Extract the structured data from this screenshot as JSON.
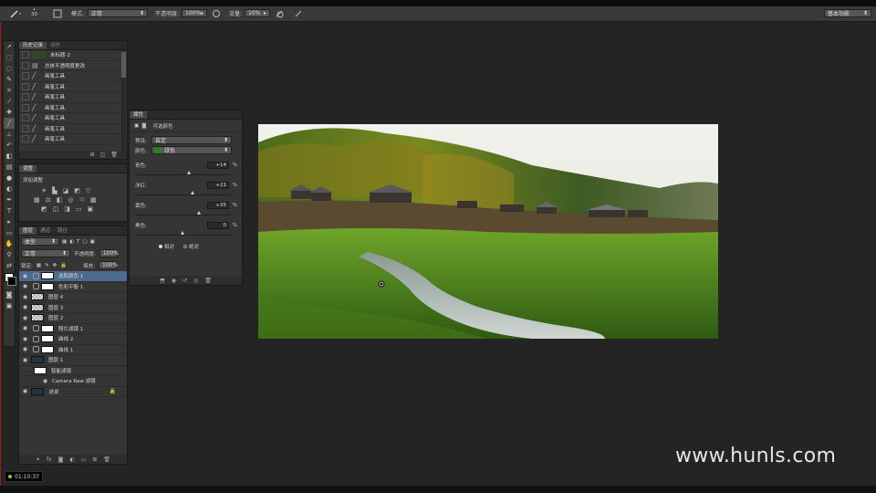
{
  "options_bar": {
    "brush_size": "30",
    "mode_label": "模式:",
    "mode_value": "正常",
    "opacity_label": "不透明度:",
    "opacity_value": "100%",
    "flow_label": "流量:",
    "flow_value": "10%",
    "workspace": "基本功能"
  },
  "history_panel": {
    "tabs": [
      "历史记录",
      "动作"
    ],
    "snapshot": "未标题-2",
    "items": [
      "总体不透明度更改",
      "画笔工具",
      "画笔工具",
      "画笔工具",
      "画笔工具",
      "画笔工具",
      "画笔工具",
      "画笔工具"
    ]
  },
  "adjust_panel": {
    "tab": "调整",
    "title": "添加调整"
  },
  "layers_panel": {
    "tabs": [
      "图层",
      "通道",
      "路径"
    ],
    "filter_value": "类型",
    "blend_value": "正常",
    "opacity_label": "不透明度:",
    "opacity_value": "100%",
    "lock_label": "锁定:",
    "fill_label": "填充:",
    "fill_value": "100%",
    "layers": [
      {
        "name": "选取颜色 1",
        "thumb": "white",
        "adj": true,
        "selected": true
      },
      {
        "name": "色彩平衡 1",
        "thumb": "white",
        "adj": true,
        "selected": false
      },
      {
        "name": "图层 4",
        "thumb": "checker",
        "adj": false,
        "selected": false
      },
      {
        "name": "图层 3",
        "thumb": "checker",
        "adj": false,
        "selected": false
      },
      {
        "name": "图层 2",
        "thumb": "checker",
        "adj": false,
        "selected": false
      },
      {
        "name": "照片滤镜 1",
        "thumb": "white",
        "adj": true,
        "selected": false
      },
      {
        "name": "曲线 2",
        "thumb": "white",
        "adj": true,
        "selected": false
      },
      {
        "name": "曲线 1",
        "thumb": "white",
        "adj": true,
        "selected": false
      },
      {
        "name": "图层 1",
        "thumb": "dark",
        "adj": false,
        "selected": false
      },
      {
        "name": "智能滤镜",
        "thumb": "white",
        "adj": false,
        "selected": false
      },
      {
        "name": "Camera Raw 滤镜",
        "thumb": "none",
        "adj": false,
        "selected": false
      },
      {
        "name": "背景",
        "thumb": "dark",
        "adj": false,
        "selected": false
      }
    ]
  },
  "properties_panel": {
    "tab": "属性",
    "title": "可选颜色",
    "preset_label": "预设:",
    "preset_value": "自定",
    "color_label": "颜色:",
    "color_value": "绿色",
    "color_swatch": "#1e8a1e",
    "sliders": [
      {
        "label": "青色:",
        "value": "+14",
        "level": 14
      },
      {
        "label": "洋红:",
        "value": "+21",
        "level": 21
      },
      {
        "label": "黄色:",
        "value": "+35",
        "level": 35
      },
      {
        "label": "黑色:",
        "value": "0",
        "level": 0
      }
    ],
    "pct": "%",
    "radio_relative": "相对",
    "radio_absolute": "绝对"
  },
  "watermark": "www.hunls.com",
  "timer": "01:10:37"
}
